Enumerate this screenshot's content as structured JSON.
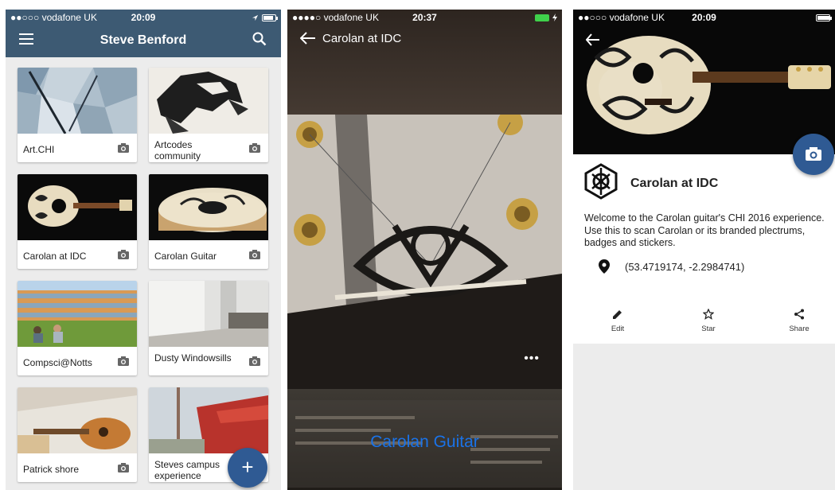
{
  "screen1": {
    "status": {
      "carrier": "●●○○○ vodafone UK",
      "time": "20:09"
    },
    "title": "Steve Benford",
    "cards": [
      {
        "label": "Art.CHI"
      },
      {
        "label": "Artcodes community"
      },
      {
        "label": "Carolan at IDC"
      },
      {
        "label": "Carolan Guitar"
      },
      {
        "label": "Compsci@Notts"
      },
      {
        "label": "Dusty Windowsills"
      },
      {
        "label": "Patrick shore"
      },
      {
        "label": "Steves campus experience"
      }
    ],
    "fab_label": "+",
    "colors": {
      "appbar": "#3d5a73",
      "fab": "#2f5a93"
    }
  },
  "screen2": {
    "status": {
      "carrier": "●●●●○ vodafone UK",
      "time": "20:37"
    },
    "title": "Carolan at IDC",
    "more_label": "•••",
    "overlay_title": "Carolan Guitar",
    "colors": {
      "overlay_title": "#1a73e8"
    }
  },
  "screen3": {
    "status": {
      "carrier": "●●○○○ vodafone UK",
      "time": "20:09"
    },
    "title": "Carolan at IDC",
    "description": "Welcome to the Carolan guitar's CHI 2016 experience. Use this to scan Carolan or its branded plectrums, badges and stickers.",
    "location": "(53.4719174, -2.2984741)",
    "actions": [
      {
        "label": "Edit",
        "icon": "pencil-icon"
      },
      {
        "label": "Star",
        "icon": "star-outline-icon"
      },
      {
        "label": "Share",
        "icon": "share-icon"
      }
    ]
  }
}
